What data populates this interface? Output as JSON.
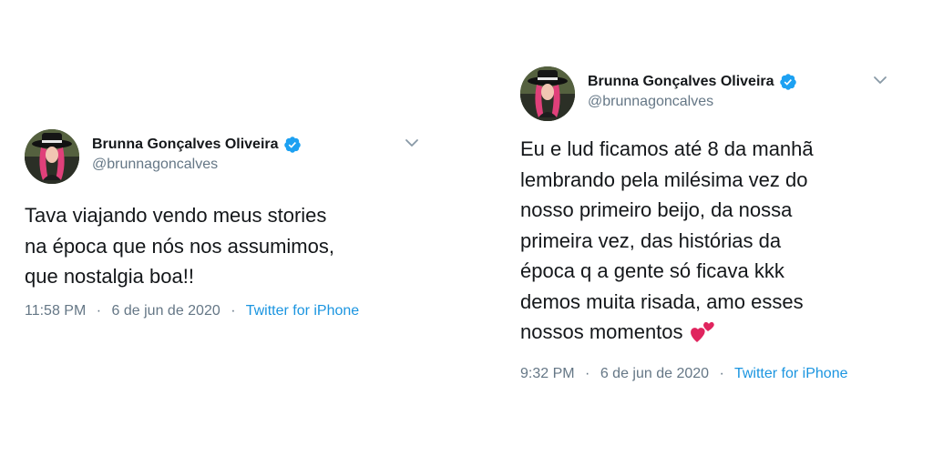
{
  "tweets": [
    {
      "display_name": "Brunna Gonçalves Oliveira",
      "handle": "@brunnagoncalves",
      "text": "Tava viajando vendo meus stories\nna época que nós nos assumimos,\nque nostalgia boa!!",
      "time": "11:58 PM",
      "date": "6 de jun de 2020",
      "separator": "·",
      "source": "Twitter for iPhone",
      "emoji": ""
    },
    {
      "display_name": "Brunna Gonçalves Oliveira",
      "handle": "@brunnagoncalves",
      "text": "Eu e lud ficamos até 8 da manhã\nlembrando pela milésima vez do\nnosso primeiro beijo, da nossa\nprimeira vez, das histórias da\népoca q a gente só ficava kkk\ndemos muita risada, amo esses\nnossos momentos",
      "time": "9:32 PM",
      "date": "6 de jun de 2020",
      "separator": "·",
      "source": "Twitter for iPhone",
      "emoji": "two-hearts"
    }
  ],
  "colors": {
    "text": "#14171a",
    "secondary": "#657786",
    "link": "#1b95e0",
    "verified": "#1da1f2",
    "heart": "#e0245e"
  },
  "icons": {
    "verified": "verified-badge-icon",
    "caret": "chevron-down-icon",
    "emoji": "two-hearts-emoji-icon"
  }
}
